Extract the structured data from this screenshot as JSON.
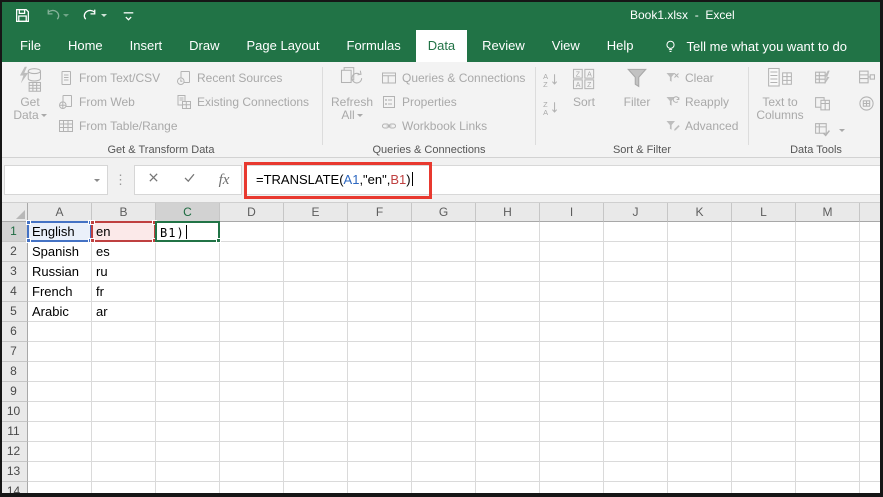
{
  "window": {
    "title": "Book1.xlsx  -  Excel"
  },
  "qat": {
    "icons": [
      "save-icon",
      "undo-icon",
      "redo-icon",
      "customize-quick-access-icon"
    ]
  },
  "tabs": {
    "items": [
      "File",
      "Home",
      "Insert",
      "Draw",
      "Page Layout",
      "Formulas",
      "Data",
      "Review",
      "View",
      "Help"
    ],
    "active": "Data",
    "tell_me": "Tell me what you want to do"
  },
  "ribbon": {
    "get_transform": {
      "label": "Get & Transform Data",
      "get_data": "Get Data",
      "from_text_csv": "From Text/CSV",
      "from_web": "From Web",
      "from_table_range": "From Table/Range",
      "recent_sources": "Recent Sources",
      "existing_connections": "Existing Connections"
    },
    "queries": {
      "label": "Queries & Connections",
      "refresh_all": "Refresh All",
      "queries_connections": "Queries & Connections",
      "properties": "Properties",
      "workbook_links": "Workbook Links"
    },
    "sort_filter": {
      "label": "Sort & Filter",
      "sort": "Sort",
      "filter": "Filter",
      "clear": "Clear",
      "reapply": "Reapply",
      "advanced": "Advanced"
    },
    "data_tools": {
      "label": "Data Tools",
      "text_to_columns": "Text to Columns",
      "icons": [
        "flash-fill-icon",
        "remove-duplicates-icon",
        "data-validation-icon",
        "consolidate-icon",
        "data-model-icon"
      ]
    }
  },
  "formula_bar": {
    "name_box": "",
    "fx_label": "fx",
    "formula": {
      "p1": "=TRANSLATE(",
      "ref1": "A1",
      "p2": ",\"en\",",
      "ref2": "B1",
      "p3": ")"
    }
  },
  "colors": {
    "excel_green": "#217346",
    "annotation_red": "#e8392f",
    "ref_blue": "#4472c4",
    "ref_red": "#bf4040",
    "ref_blue_fill": "#eaf0fa",
    "ref_red_fill": "#fbe9e9"
  },
  "grid": {
    "columns": [
      "A",
      "B",
      "C",
      "D",
      "E",
      "F",
      "G",
      "H",
      "I",
      "J",
      "K",
      "L",
      "M"
    ],
    "active_column": "C",
    "active_row": 1,
    "visible_rows": 13,
    "partial_row": 14,
    "cells": {
      "A1": "English",
      "A2": "Spanish",
      "A3": "Russian",
      "A4": "French",
      "A5": "Arabic",
      "B1": "en",
      "B2": "es",
      "B3": "ru",
      "B4": "fr",
      "B5": "ar"
    },
    "edit_cell": {
      "ref": "C1",
      "visible_text": "B1)"
    },
    "highlights": {
      "A1": {
        "border": "#4472c4",
        "fill": "#eaf0fa",
        "fill_target": "cell",
        "handles": "corners"
      },
      "B1": {
        "border": "#bf4040",
        "fill": "#fbe9e9",
        "fill_target": "cell",
        "handles": "corners"
      },
      "C1": {
        "border": "#217346",
        "fill": "#ffffff",
        "fill_target": "overlay",
        "handles": "fill"
      }
    }
  }
}
